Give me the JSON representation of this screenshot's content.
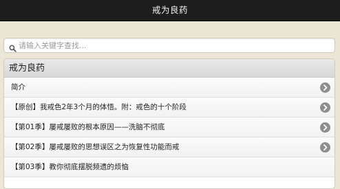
{
  "header": {
    "title": "戒为良药"
  },
  "search": {
    "placeholder": "请输入关键字查找..."
  },
  "list": {
    "heading": "戒为良药",
    "items": [
      {
        "label": "简介"
      },
      {
        "label": "【原创】我戒色2年3个月的体悟。附：戒色的十个阶段"
      },
      {
        "label": "【第01季】屡戒屡败的根本原因——洗脑不彻底"
      },
      {
        "label": "【第02季】屡戒屡败的思想误区之为恢复性功能而戒"
      },
      {
        "label": "【第03季】教你彻底摆脱频遗的烦恼"
      }
    ]
  },
  "icons": {
    "search": "search-icon",
    "item_arrow": "chevron-right-icon"
  },
  "colors": {
    "titlebar": "#1d1d1d",
    "background": "#ece6d6",
    "chevron": "#8e8e8e"
  }
}
